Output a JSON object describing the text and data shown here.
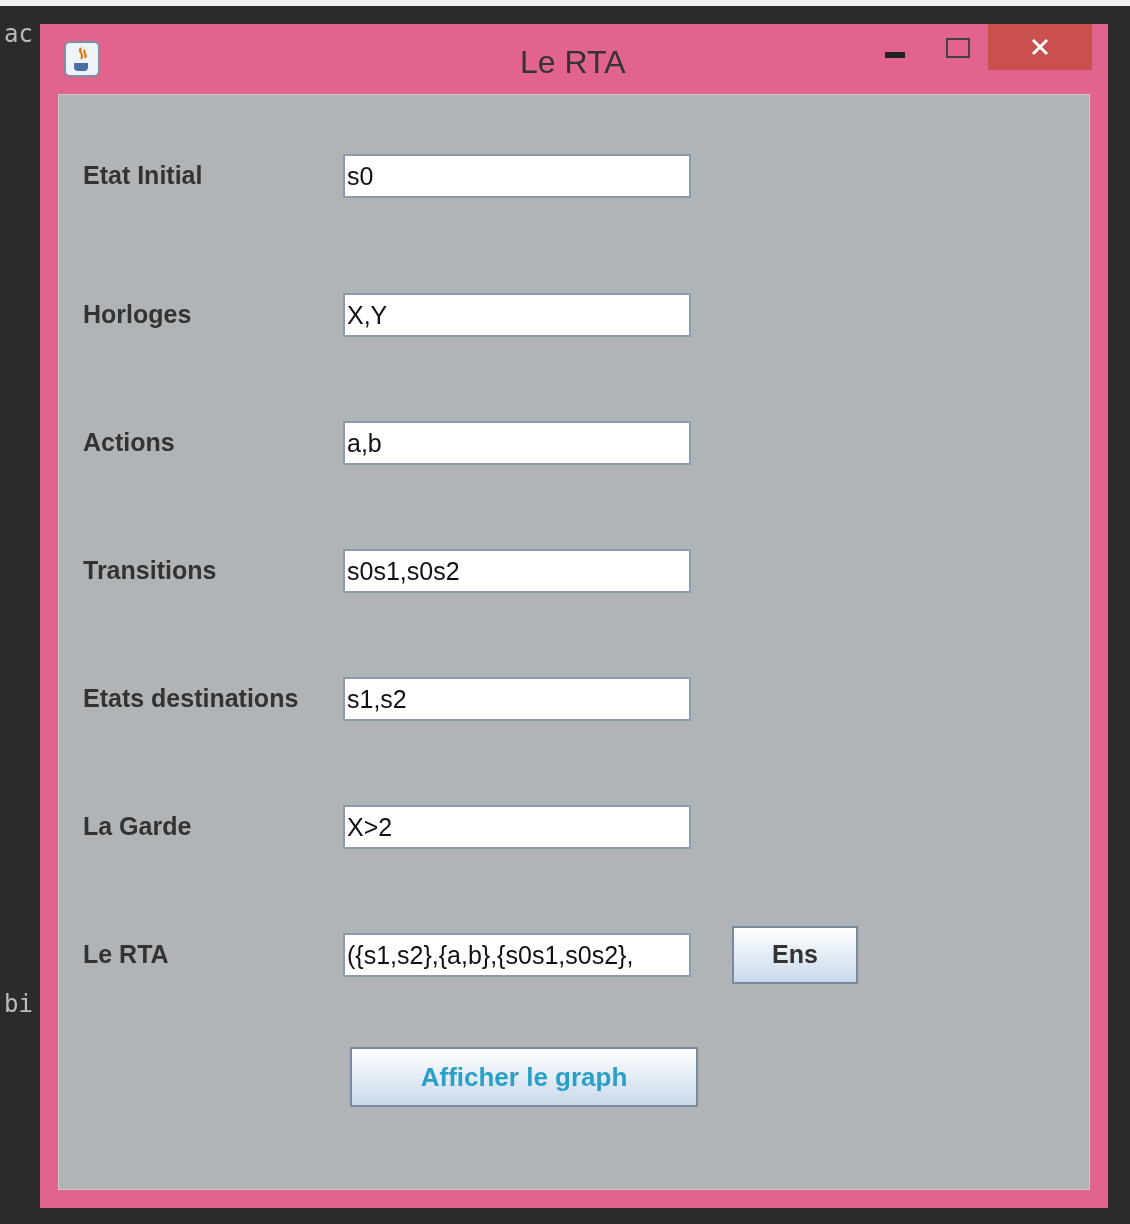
{
  "backdrop": {
    "texts": [
      "ac",
      "bi"
    ]
  },
  "window": {
    "title": "Le RTA"
  },
  "fields": [
    {
      "label": "Etat Initial",
      "value": "s0"
    },
    {
      "label": "Horloges",
      "value": "X,Y"
    },
    {
      "label": "Actions",
      "value": "a,b"
    },
    {
      "label": "Transitions",
      "value": "s0s1,s0s2"
    },
    {
      "label": "Etats destinations",
      "value": "s1,s2"
    },
    {
      "label": "La Garde",
      "value": "X>2"
    },
    {
      "label": "Le RTA",
      "value": "({s1,s2},{a,b},{s0s1,s0s2},",
      "button": "Ens"
    }
  ],
  "action_button": "Afficher le graph"
}
